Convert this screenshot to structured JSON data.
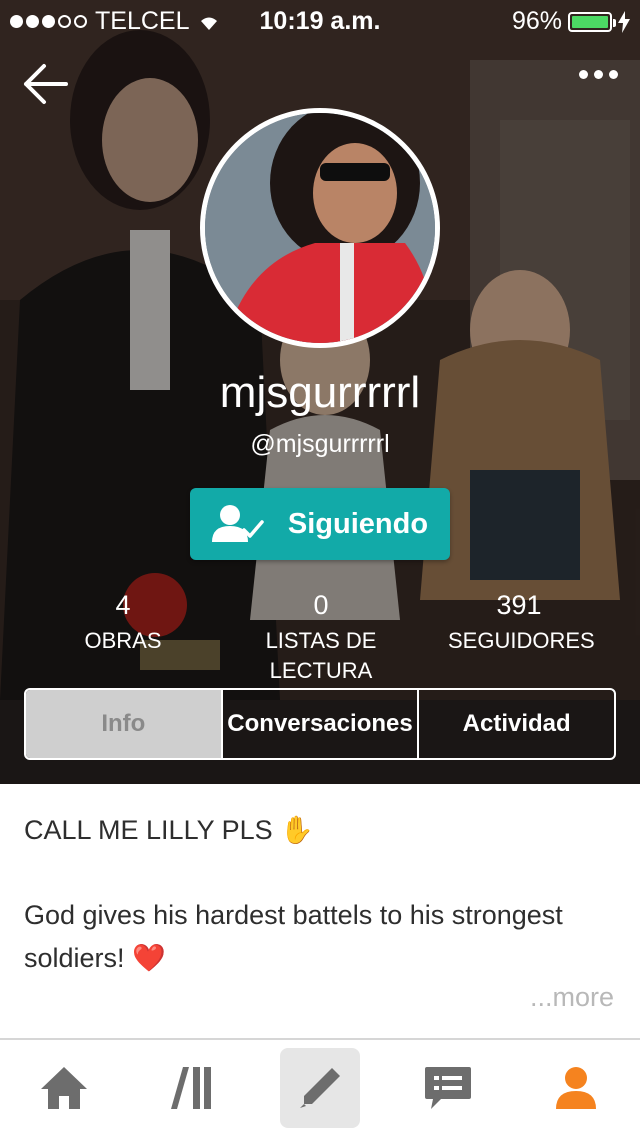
{
  "status_bar": {
    "carrier": "TELCEL",
    "time": "10:19 a.m.",
    "battery": "96%"
  },
  "profile": {
    "display_name": "mjsgurrrrrl",
    "handle": "@mjsgurrrrrl",
    "follow_label": "Siguiendo"
  },
  "stats": [
    {
      "value": "4",
      "label": "OBRAS"
    },
    {
      "value": "0",
      "label": "LISTAS DE LECTURA"
    },
    {
      "value": "391",
      "label": "SEGUIDORES"
    }
  ],
  "tabs": [
    {
      "label": "Info",
      "active": true
    },
    {
      "label": "Conversaciones",
      "active": false
    },
    {
      "label": "Actividad",
      "active": false
    }
  ],
  "bio": {
    "line1": "CALL ME LILLY PLS ✋",
    "line2": "God gives his hardest battels to his strongest soldiers! ❤️",
    "more": "...more"
  },
  "tab_bar": {
    "items": [
      "home-icon",
      "library-icon",
      "write-icon",
      "messages-icon",
      "profile-icon"
    ],
    "active_color": "#f5831f",
    "inactive_color": "#6d6d6d"
  },
  "colors": {
    "accent": "#12aaa8",
    "battery": "#4cd964"
  }
}
